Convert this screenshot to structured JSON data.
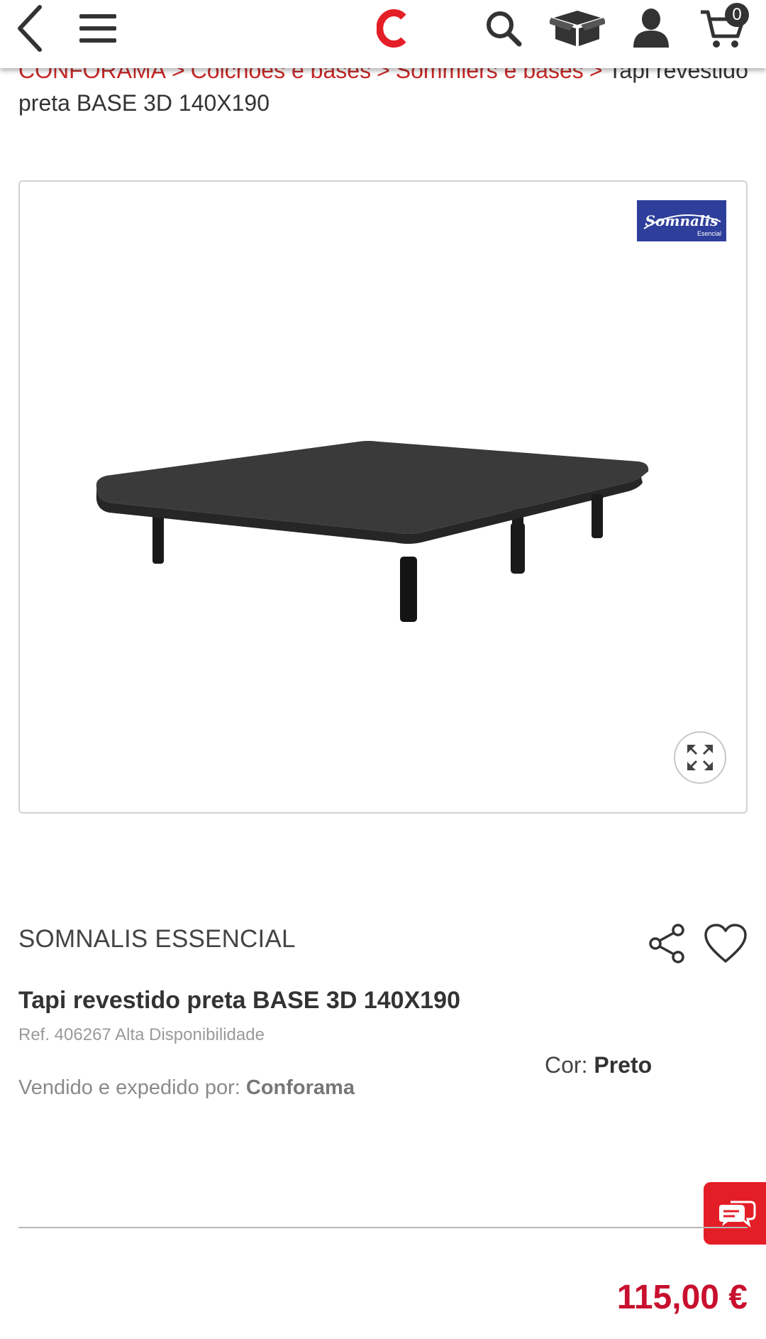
{
  "header": {
    "cart_count": "0",
    "accent_color": "#e41e26",
    "icons": [
      "back-arrow-icon",
      "hamburger-menu-icon",
      "conforama-logo",
      "search-icon",
      "box-icon",
      "user-icon",
      "cart-icon"
    ]
  },
  "breadcrumb": {
    "items": [
      "CONFORAMA",
      "Colchões e bases",
      "Sommiers e bases"
    ],
    "separator": ">",
    "current": "Tapi revestido preta BASE 3D 140X190"
  },
  "gallery": {
    "brand_logo_name": "Somnalis",
    "brand_logo_sub": "Esencial",
    "logo_color": "#2e3f9b"
  },
  "product": {
    "brand": "SOMNALIS ESSENCIAL",
    "title": "Tapi revestido preta BASE 3D 140X190",
    "ref": "Ref. 406267 Alta Disponibilidade",
    "color_label": "Cor:",
    "color_value": "Preto",
    "seller_label": "Vendido e expedido por:",
    "seller_value": "Conforama",
    "price": "115,00 €",
    "price_color": "#c8102e"
  }
}
